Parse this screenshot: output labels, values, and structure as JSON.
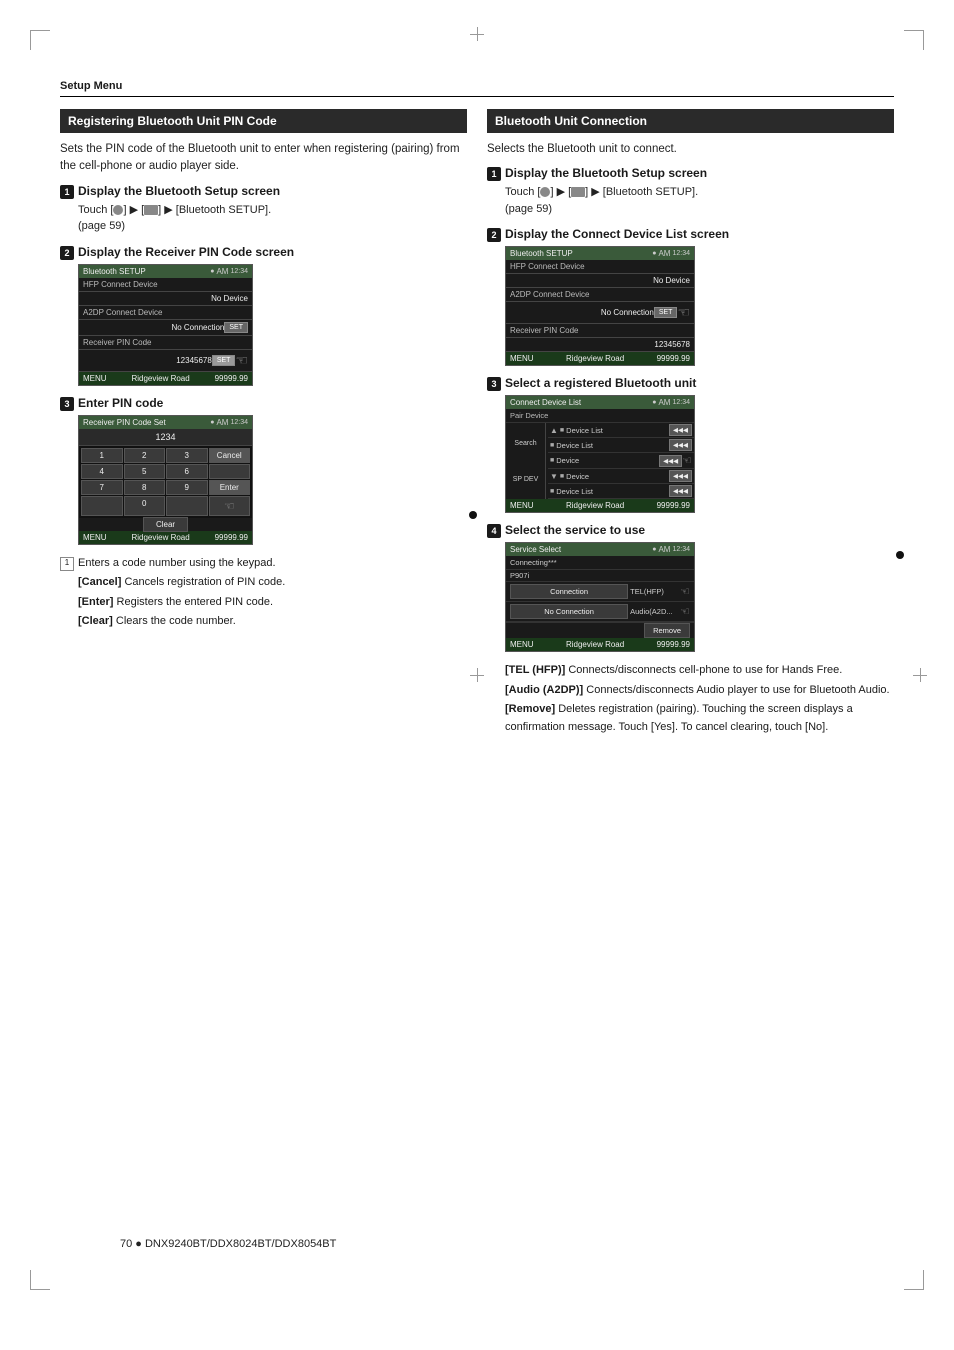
{
  "page": {
    "header_label": "Setup Menu",
    "footer_text": "70 ● DNX9240BT/DDX8024BT/DDX8054BT"
  },
  "left_section": {
    "title": "Registering Bluetooth Unit PIN Code",
    "description": "Sets the PIN code of the Bluetooth unit to enter when registering (pairing) from the cell-phone or audio player side.",
    "steps": [
      {
        "num": "1",
        "title": "Display the Bluetooth Setup screen",
        "body": "Touch [  ] ▶ [  ] ▶ [Bluetooth SETUP]. (page 59)"
      },
      {
        "num": "2",
        "title": "Display the Receiver PIN Code screen",
        "body": ""
      },
      {
        "num": "3",
        "title": "Enter PIN code",
        "body": ""
      }
    ],
    "notes": [
      {
        "icon": "1",
        "text": "Enters a code number using the keypad."
      },
      {
        "key": "[Cancel]",
        "text": "Cancels registration of PIN code."
      },
      {
        "key": "[Enter]",
        "text": "Registers the entered PIN code."
      },
      {
        "key": "[Clear]",
        "text": "Clears the code number."
      }
    ],
    "screen1": {
      "title": "Bluetooth SETUP",
      "rows": [
        {
          "label": "HFP Connect Device",
          "value": ""
        },
        {
          "label": "",
          "value": "No Device"
        },
        {
          "label": "A2DP Connect Device",
          "value": ""
        },
        {
          "label": "",
          "value": "No Connection",
          "btn": "SET"
        },
        {
          "label": "Receiver PIN Code",
          "value": ""
        },
        {
          "label": "",
          "value": "12345678",
          "btn": "SET"
        }
      ],
      "bottom_left": "MENU",
      "bottom_road": "Ridgeview Road",
      "bottom_right": "99999.99"
    },
    "screen2": {
      "title": "Receiver PIN Code Set",
      "input": "1234",
      "keys": [
        "1",
        "2",
        "3",
        "Cancel",
        "4",
        "5",
        "6",
        "",
        "7",
        "8",
        "9",
        "Enter",
        "",
        "0",
        "",
        ""
      ],
      "clear_label": "Clear",
      "bottom_left": "MENU",
      "bottom_road": "Ridgeview Road",
      "bottom_right": "99999.99"
    }
  },
  "right_section": {
    "title": "Bluetooth Unit Connection",
    "description": "Selects the Bluetooth unit to connect.",
    "steps": [
      {
        "num": "1",
        "title": "Display the Bluetooth Setup screen",
        "body": "Touch [  ] ▶ [  ] ▶ [Bluetooth SETUP]. (page 59)"
      },
      {
        "num": "2",
        "title": "Display the Connect Device List screen",
        "body": ""
      },
      {
        "num": "3",
        "title": "Select a registered Bluetooth unit",
        "body": ""
      },
      {
        "num": "4",
        "title": "Select the service to use",
        "body": ""
      }
    ],
    "screen1": {
      "title": "Bluetooth SETUP",
      "rows": [
        {
          "label": "HFP Connect Device",
          "value": ""
        },
        {
          "label": "",
          "value": "No Device"
        },
        {
          "label": "A2DP Connect Device",
          "value": ""
        },
        {
          "label": "",
          "value": "No Connection",
          "btn": "SET"
        },
        {
          "label": "Receiver PIN Code",
          "value": ""
        },
        {
          "label": "",
          "value": "12345678"
        }
      ],
      "bottom_left": "MENU",
      "bottom_road": "Ridgeview Road",
      "bottom_right": "99999.99"
    },
    "screen2": {
      "title": "Connect Device List",
      "subtitle": "Pair Device",
      "search_label": "Search",
      "devices": [
        {
          "arrow": "▲",
          "name": "Device List"
        },
        {
          "arrow": "",
          "name": "Device List"
        },
        {
          "arrow": "",
          "name": "Device"
        },
        {
          "arrow": "▼",
          "name": "Device"
        },
        {
          "arrow": "",
          "name": "Device List"
        }
      ],
      "side_label": "SP DEV",
      "bottom_left": "MENU",
      "bottom_road": "Ridgeview Road",
      "bottom_right": "99999.99"
    },
    "screen3": {
      "title": "Service Select",
      "device_name": "Connecting***",
      "device_id": "P907i",
      "rows": [
        {
          "btn": "Connection",
          "type": "TEL(HFP)"
        },
        {
          "btn": "No Connection",
          "type": "Audio(A2D..."
        }
      ],
      "remove_label": "Remove",
      "bottom_left": "MENU",
      "bottom_road": "Ridgeview Road",
      "bottom_right": "99999.99"
    },
    "notes": [
      {
        "key": "[TEL (HFP)]",
        "text": "Connects/disconnects cell-phone to use for Hands Free."
      },
      {
        "key": "[Audio (A2DP)]",
        "text": "Connects/disconnects Audio player to use for Bluetooth Audio."
      },
      {
        "key": "[Remove]",
        "text": "Deletes registration (pairing). Touching the screen displays a confirmation message. Touch [Yes]. To cancel clearing, touch [No]."
      }
    ]
  }
}
